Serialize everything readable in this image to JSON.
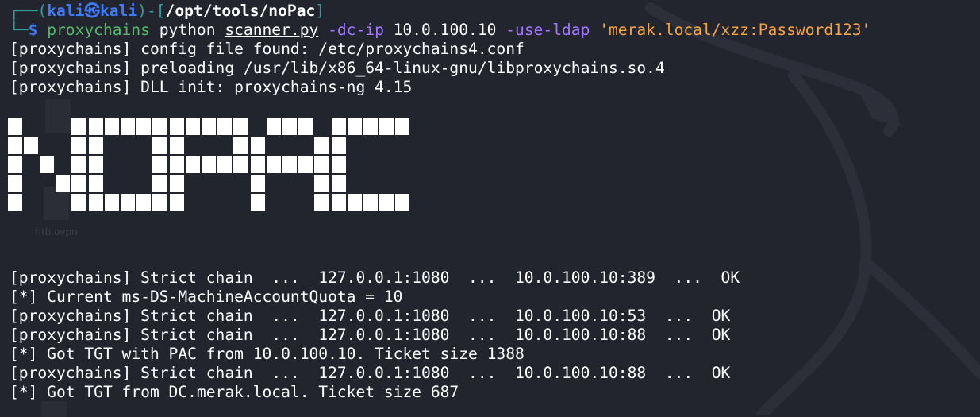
{
  "prompt": {
    "user": "kali",
    "host": "kali",
    "path": "/opt/tools/noPac",
    "symbol": "$"
  },
  "command": {
    "exec": "proxychains",
    "program": "python",
    "script": "scanner.py",
    "flag_dc_ip": "-dc-ip",
    "dc_ip": "10.0.100.10",
    "flag_ldap": "-use-ldap",
    "creds": "'merak.local/xzz:Password123'"
  },
  "preamble": [
    "[proxychains] config file found: /etc/proxychains4.conf",
    "[proxychains] preloading /usr/lib/x86_64-linux-gnu/libproxychains.so.4",
    "[proxychains] DLL init: proxychains-ng 4.15"
  ],
  "banner": {
    "text": "NOPAC",
    "color": "#ffffff"
  },
  "output": [
    "[proxychains] Strict chain  ...  127.0.0.1:1080  ...  10.0.100.10:389  ...  OK",
    "[*] Current ms-DS-MachineAccountQuota = 10",
    "[proxychains] Strict chain  ...  127.0.0.1:1080  ...  10.0.100.10:53  ...  OK",
    "[proxychains] Strict chain  ...  127.0.0.1:1080  ...  10.0.100.10:88  ...  OK",
    "[*] Got TGT with PAC from 10.0.100.10. Ticket size 1388",
    "[proxychains] Strict chain  ...  127.0.0.1:1080  ...  10.0.100.10:88  ...  OK",
    "[*] Got TGT from DC.merak.local. Ticket size 687"
  ],
  "desktop": {
    "file_label": "htb.ovpn"
  },
  "colors": {
    "background": "#23252e",
    "prompt_frame": "#2f9ea1",
    "user_host": "#3e7cf7",
    "command": "#53b86a",
    "flags": "#a277ff",
    "string": "#f6a541"
  }
}
